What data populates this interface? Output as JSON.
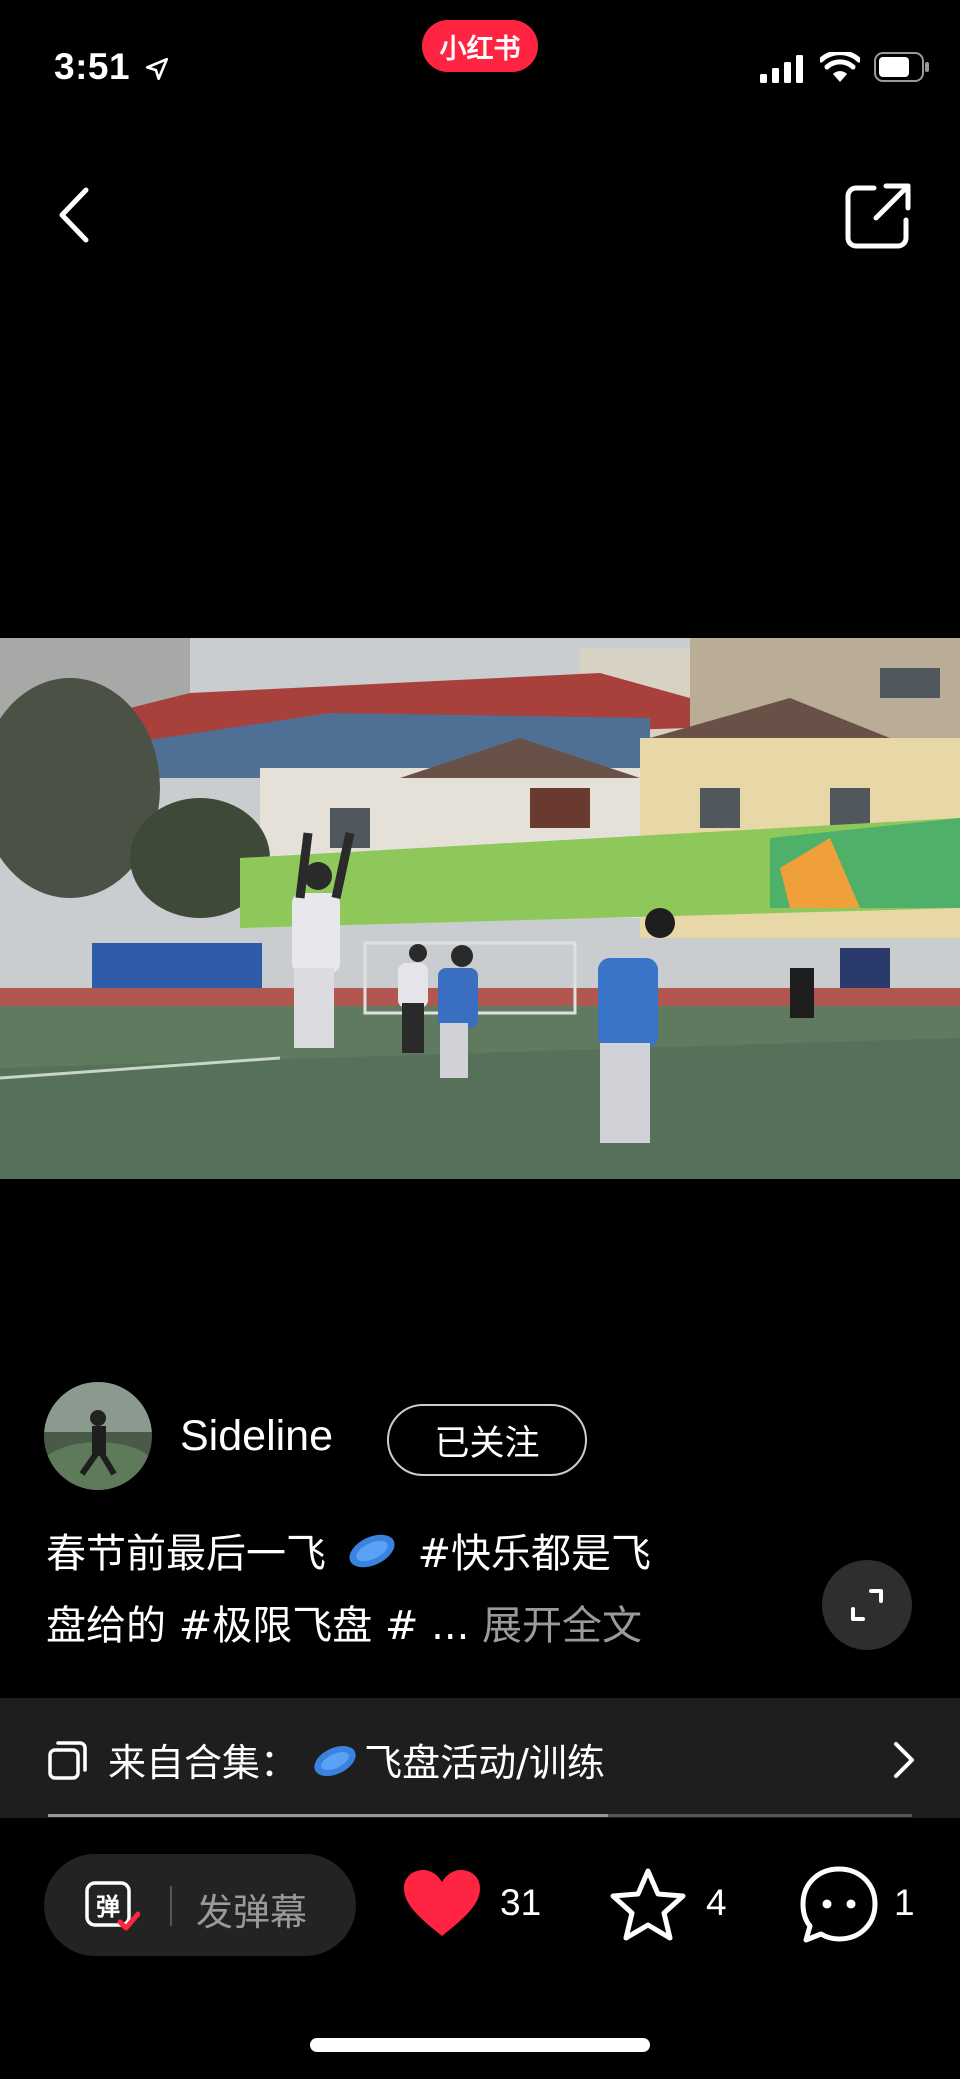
{
  "status_bar": {
    "time": "3:51",
    "app_badge": "小红书"
  },
  "icons": {
    "back": "chevron-left-icon",
    "share": "share-icon",
    "fullscreen": "fullscreen-icon",
    "collection": "collection-icon",
    "danmaku": "danmaku-icon",
    "like": "heart-icon",
    "favorite": "star-icon",
    "comment": "comment-icon"
  },
  "colors": {
    "brand": "#ff2442",
    "like": "#ff2442",
    "muted": "#9a9a9a"
  },
  "author": {
    "name": "Sideline",
    "follow_label": "已关注"
  },
  "caption": {
    "line1_a": "春节前最后一飞",
    "line1_b": "#快乐都是飞",
    "line2": "盘给的  #极限飞盘  # ...",
    "expand_label": "展开全文"
  },
  "collection": {
    "prefix": "来自合集：",
    "name": "飞盘活动/训练"
  },
  "video": {
    "progress": 0.648
  },
  "actions": {
    "danmaku_placeholder": "发弹幕",
    "likes": "31",
    "favorites": "4",
    "comments": "1"
  }
}
